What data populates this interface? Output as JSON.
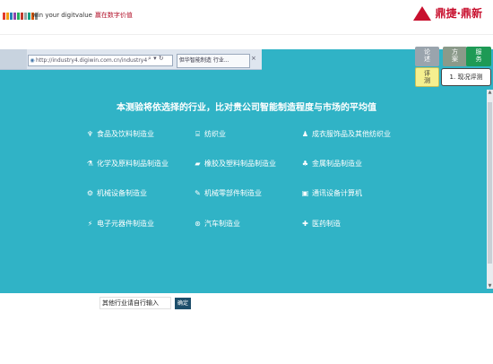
{
  "header": {
    "stripe_colors": [
      "#e33a2b",
      "#f39c12",
      "#2980b9",
      "#8e44ad",
      "#27ae60",
      "#c0392b",
      "#95a5a6",
      "#16a085",
      "#d35400",
      "#7f8c8d"
    ],
    "slogan": "win your digitvalue",
    "slogan_cn": "赢在数字价值",
    "brand": "鼎捷·鼎新",
    "brand_color": "#c8102e"
  },
  "browser": {
    "address": "http://industry4.digiwin.com.cn/industry4",
    "tab_title": "但华智能制造 行业...",
    "nav_icons": "⌕ ▾ ↻"
  },
  "side_buttons": {
    "b1": "论\n述",
    "b2": "方\n案",
    "b3": "服\n务",
    "b4": "评\n测",
    "b5": "1. 现况评测"
  },
  "main": {
    "headline": "本测验将依选择的行业，比对贵公司智能制造程度与市场的平均值",
    "background": "#30b3c6",
    "industries": [
      {
        "icon": "bottle-icon",
        "glyph": "♆",
        "label": "食品及饮料制造业"
      },
      {
        "icon": "loom-icon",
        "glyph": "⌸",
        "label": "纺织业"
      },
      {
        "icon": "people-icon",
        "glyph": "♟",
        "label": "成衣服饰品及其他纺织业"
      },
      {
        "icon": "chemistry-icon",
        "glyph": "⚗",
        "label": "化学及原料制品制造业"
      },
      {
        "icon": "plastic-icon",
        "glyph": "▰",
        "label": "橡胶及塑料制品制造业"
      },
      {
        "icon": "metal-icon",
        "glyph": "♣",
        "label": "金属制品制造业"
      },
      {
        "icon": "machine-icon",
        "glyph": "⚙",
        "label": "机械设备制造业"
      },
      {
        "icon": "parts-icon",
        "glyph": "✎",
        "label": "机械零部件制造业"
      },
      {
        "icon": "computer-icon",
        "glyph": "▣",
        "label": "通讯设备计算机"
      },
      {
        "icon": "electronics-icon",
        "glyph": "⚡",
        "label": "电子元器件制造业"
      },
      {
        "icon": "car-icon",
        "glyph": "⊛",
        "label": "汽车制造业"
      },
      {
        "icon": "medicine-icon",
        "glyph": "✚",
        "label": "医药制造"
      }
    ],
    "other_placeholder": "其他行业请自行输入",
    "confirm_label": "确定"
  }
}
